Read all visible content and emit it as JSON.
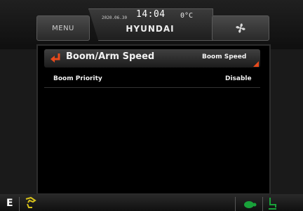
{
  "header": {
    "menu_label": "MENU",
    "date": "2020.06.30",
    "time": "14:04",
    "temperature": "0°C",
    "brand": "HYUNDAI",
    "fan_icon": "fan-icon"
  },
  "panel": {
    "title": "Boom/Arm Speed",
    "mode_label": "Boom Speed",
    "back_icon": "return-arrow-icon",
    "rows": [
      {
        "label": "Boom Priority",
        "value": "Disable"
      }
    ]
  },
  "footer": {
    "gear_letter": "E",
    "left_icon": "work-mode-icon",
    "right_icons": [
      "turtle-icon",
      "operator-seat-icon"
    ]
  },
  "colors": {
    "accent": "#e84a1c",
    "icon_yellow": "#d8c21a",
    "icon_green": "#19a23a"
  }
}
